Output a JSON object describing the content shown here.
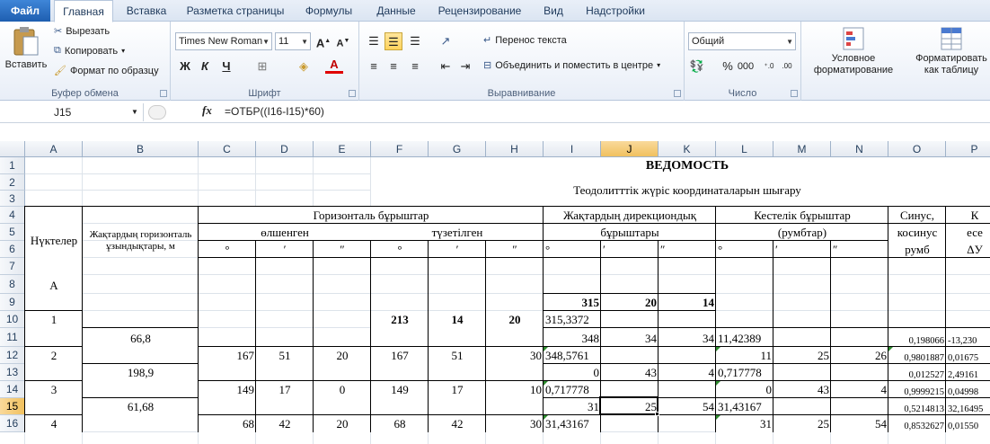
{
  "ribbon_tabs": [
    "Файл",
    "Главная",
    "Вставка",
    "Разметка страницы",
    "Формулы",
    "Данные",
    "Рецензирование",
    "Вид",
    "Надстройки"
  ],
  "clipboard": {
    "paste": "Вставить",
    "cut": "Вырезать",
    "copy": "Копировать",
    "format_painter": "Формат по образцу",
    "label": "Буфер обмена"
  },
  "font": {
    "name": "Times New Roman",
    "size": "11",
    "label": "Шрифт"
  },
  "alignment": {
    "wrap": "Перенос текста",
    "merge": "Объединить и поместить в центре",
    "label": "Выравнивание"
  },
  "number": {
    "format": "Общий",
    "label": "Число"
  },
  "styles": {
    "cond_l1": "Условное",
    "cond_l2": "форматирование",
    "table_l1": "Форматировать",
    "table_l2": "как таблицу"
  },
  "formula_bar": {
    "cell_ref": "J15",
    "fx": "fx",
    "formula": "=ОТБР((I16-I15)*60)"
  },
  "columns": [
    "A",
    "B",
    "C",
    "D",
    "E",
    "F",
    "G",
    "H",
    "I",
    "J",
    "K",
    "L",
    "M",
    "N",
    "O",
    "P"
  ],
  "rows": [
    "1",
    "2",
    "3",
    "4",
    "5",
    "6",
    "7",
    "8",
    "9",
    "10",
    "11",
    "12",
    "13",
    "14",
    "15",
    "16"
  ],
  "selected": {
    "col": "J",
    "row": "15"
  },
  "colors": {
    "accent": "#1e5eb0",
    "selection_header": "#f1c15f",
    "error_marker": "#2e8b2e"
  },
  "sheet": {
    "title": "ВЕДОМОСТЬ",
    "subtitle": "Теодолитттік жүріс координаталарын шығару",
    "h_points": "Нүктелер",
    "h_length": "Жақтардың горизонталь ұзындықтары, м",
    "h_angles": "Горизонталь бұрыштар",
    "h_measured": "өлшенген",
    "h_corrected": "түзетілген",
    "h_dir1": "Жақтардың дирекциондық",
    "h_dir2": "бұрыштары",
    "h_tab1": "Кестелік бұрыштар",
    "h_tab2": "(румбтар)",
    "h_sin1": "Синус,",
    "h_sin2": "косинус",
    "h_sin3": "румб",
    "h_P4": "К",
    "h_P5": "есе",
    "h_P6": "ΔУ",
    "deg": "°",
    "min": "′",
    "sec": "″",
    "A8": "А",
    "I9": "315",
    "J9": "20",
    "K9": "14",
    "A10": "1",
    "F10": "213",
    "G10": "14",
    "H10": "20",
    "I10": "315,3372",
    "B11": "66,8",
    "I11": "348",
    "J11": "34",
    "K11": "34",
    "L11": "11,42389",
    "O11": "0,198066",
    "P11": "-13,230",
    "A12": "2",
    "C12": "167",
    "D12": "51",
    "E12": "20",
    "F12": "167",
    "G12": "51",
    "H12": "30",
    "I12": "348,5761",
    "L12": "11",
    "M12": "25",
    "N12": "26",
    "O12": "0,9801887",
    "P12": "0,01675",
    "B13": "198,9",
    "I13": "0",
    "J13": "43",
    "K13": "4",
    "L13": "0,717778",
    "O13": "0,012527",
    "P13": "2,49161",
    "A14": "3",
    "C14": "149",
    "D14": "17",
    "E14": "0",
    "F14": "149",
    "G14": "17",
    "H14": "10",
    "I14": "0,717778",
    "L14": "0",
    "M14": "43",
    "N14": "4",
    "O14": "0,9999215",
    "P14": "0,04998",
    "B15": "61,68",
    "I15": "31",
    "J15": "25",
    "K15": "54",
    "L15": "31,43167",
    "O15": "0,5214813",
    "P15": "32,16495",
    "A16": "4",
    "C16": "68",
    "D16": "42",
    "E16": "20",
    "F16": "68",
    "G16": "42",
    "H16": "30",
    "I16": "31,43167",
    "L16": "31",
    "M16": "25",
    "N16": "54",
    "O16": "0,8532627",
    "P16": "0,01550"
  }
}
